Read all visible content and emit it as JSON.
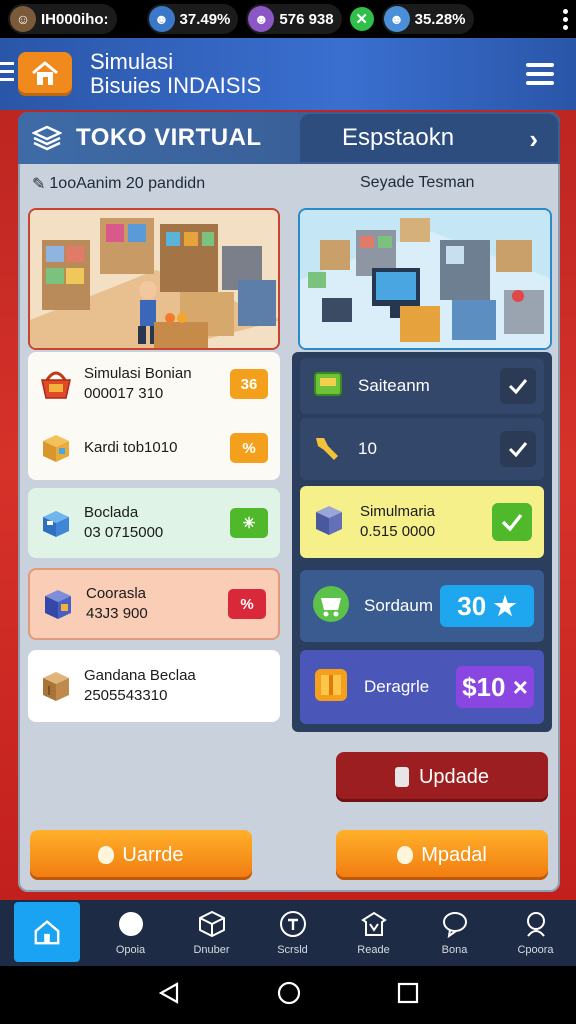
{
  "status_bar": {
    "user_label": "IH000iho:",
    "stat1": "37.49%",
    "stat2": "576 938",
    "stat3": "35.28%"
  },
  "header": {
    "title_line1": "Simulasi",
    "title_line2": "Bisuies INDAISIS"
  },
  "panel": {
    "tab_left": "TOKO VIRTUAL",
    "tab_right": "Espstaokn",
    "sub_left": "1ooAanim 20 pandidn",
    "sub_right": "Seyade Tesman"
  },
  "left_cards": [
    {
      "title": "Simulasi Bonian",
      "value": "000017 310",
      "badge": "36",
      "badge_color": "#f4a01c"
    },
    {
      "title": "Kardi tob1010",
      "value": "",
      "badge": "%",
      "badge_color": "#f4a01c"
    },
    {
      "title": "Boclada",
      "value": "03 0715000",
      "badge": "✳",
      "badge_color": "#4fb82b"
    },
    {
      "title": "Coorasla",
      "value": "43J3 900",
      "badge": "%",
      "badge_color": "#d9283a"
    },
    {
      "title": "Gandana Beclaa",
      "value": "2505543310",
      "badge": "",
      "badge_color": ""
    }
  ],
  "right_list": [
    {
      "title": "Saiteanm",
      "value": ""
    },
    {
      "title": "10",
      "value": ""
    },
    {
      "title": "Simulmaria",
      "value": "0.515 0000"
    },
    {
      "title": "Sordaum",
      "pill": "30 ★",
      "pill_color": "#1ea6ef"
    },
    {
      "title": "Deragrle",
      "pill": "$10 ×",
      "pill_color": "#8a46e0"
    }
  ],
  "buttons": {
    "update": "Updade",
    "left_orange": "Uarrde",
    "right_orange": "Mpadal"
  },
  "bottom_nav": [
    {
      "label": "",
      "icon": "home-icon"
    },
    {
      "label": "Opoia",
      "icon": "circle-icon"
    },
    {
      "label": "Dnuber",
      "icon": "cube-icon"
    },
    {
      "label": "Scrsld",
      "icon": "t-icon"
    },
    {
      "label": "Reade",
      "icon": "store-icon"
    },
    {
      "label": "Bona",
      "icon": "chat-icon"
    },
    {
      "label": "Cpoora",
      "icon": "support-icon"
    }
  ]
}
